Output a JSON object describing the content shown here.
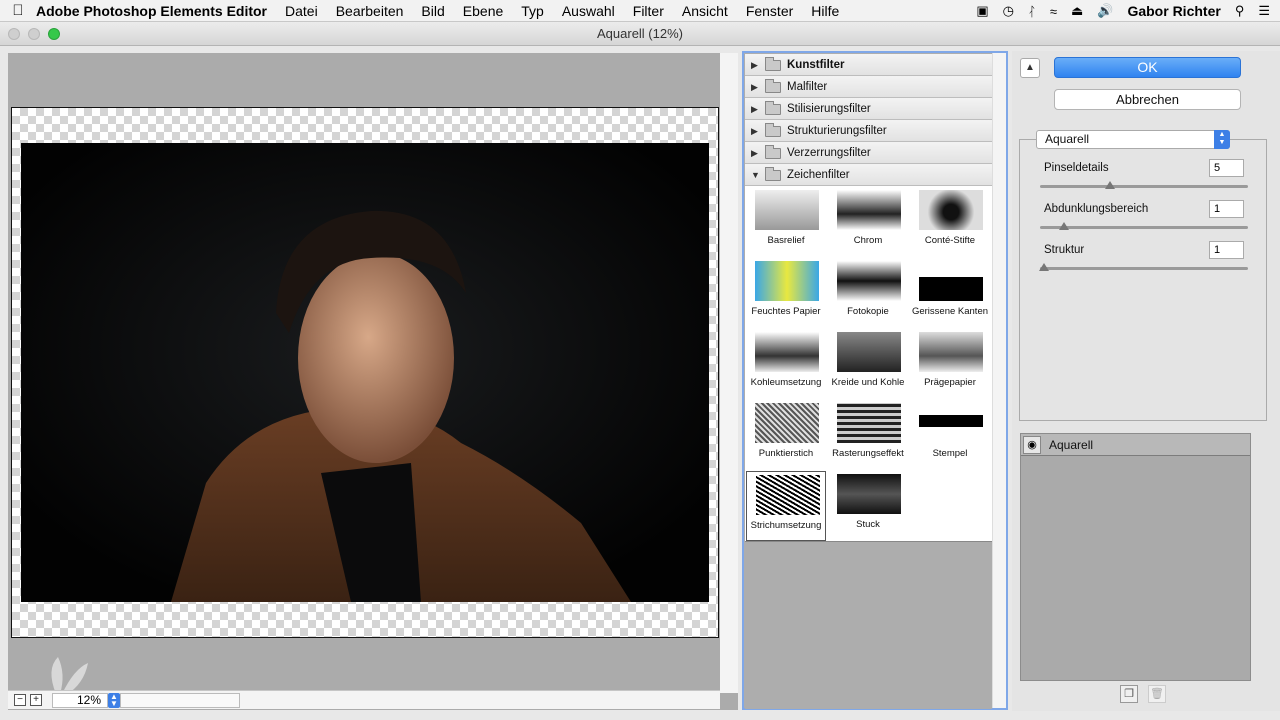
{
  "menubar": {
    "app_name": "Adobe Photoshop Elements Editor",
    "items": [
      "Datei",
      "Bearbeiten",
      "Bild",
      "Ebene",
      "Typ",
      "Auswahl",
      "Filter",
      "Ansicht",
      "Fenster",
      "Hilfe"
    ],
    "user": "Gabor Richter",
    "status_icons": [
      "display-icon",
      "time-machine-icon",
      "bluetooth-icon",
      "wifi-icon",
      "eject-icon",
      "volume-icon"
    ]
  },
  "window": {
    "title": "Aquarell (12%)"
  },
  "preview": {
    "zoom": "12%"
  },
  "gallery": {
    "categories": [
      {
        "label": "Kunstfilter",
        "expanded": false,
        "bold": true
      },
      {
        "label": "Malfilter",
        "expanded": false,
        "bold": false
      },
      {
        "label": "Stilisierungsfilter",
        "expanded": false,
        "bold": false
      },
      {
        "label": "Strukturierungsfilter",
        "expanded": false,
        "bold": false
      },
      {
        "label": "Verzerrungsfilter",
        "expanded": false,
        "bold": false
      },
      {
        "label": "Zeichenfilter",
        "expanded": true,
        "bold": false
      }
    ],
    "thumbnails": [
      "Basrelief",
      "Chrom",
      "Conté-Stifte",
      "Feuchtes Papier",
      "Fotokopie",
      "Gerissene Kanten",
      "Kohleumsetzung",
      "Kreide und Kohle",
      "Prägepapier",
      "Punktierstich",
      "Rasterungseffekt",
      "Stempel",
      "Strichumsetzung",
      "Stuck"
    ],
    "selected_thumbnail": "Strichumsetzung"
  },
  "controls": {
    "ok_label": "OK",
    "cancel_label": "Abbrechen",
    "filter_select": "Aquarell",
    "params": [
      {
        "label": "Pinseldetails",
        "value": "5",
        "fraction": 0.33
      },
      {
        "label": "Abdunklungsbereich",
        "value": "1",
        "fraction": 0.1
      },
      {
        "label": "Struktur",
        "value": "1",
        "fraction": 0.0
      }
    ],
    "layers": [
      {
        "label": "Aquarell"
      }
    ]
  },
  "colors": {
    "accent": "#2f83f0",
    "gallery_border": "#7fa7e8"
  }
}
